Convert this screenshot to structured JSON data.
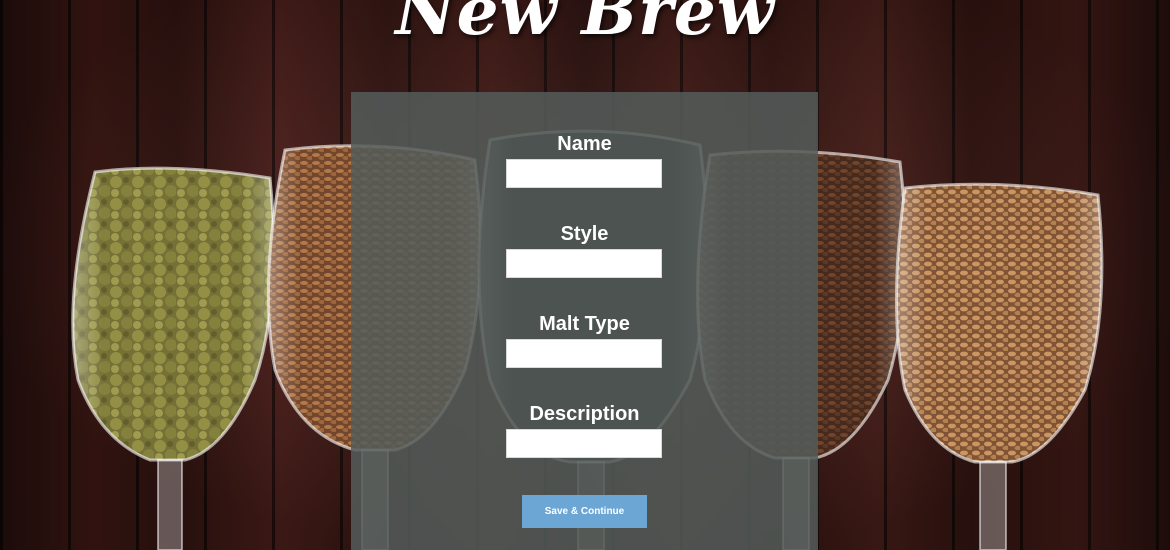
{
  "header": {
    "title": "New Brew"
  },
  "form": {
    "fields": [
      {
        "label": "Name",
        "value": "",
        "placeholder": ""
      },
      {
        "label": "Style",
        "value": "",
        "placeholder": ""
      },
      {
        "label": "Malt Type",
        "value": "",
        "placeholder": ""
      },
      {
        "label": "Description",
        "value": "",
        "placeholder": ""
      }
    ],
    "submit_label": "Save & Continue"
  },
  "background": {
    "image_subject": "glasses of hops and malt grains on wooden planks"
  },
  "colors": {
    "panel": "#545c5a",
    "button": "#6ba6d4",
    "title": "#ffffff",
    "wood": "#4a1d18"
  }
}
